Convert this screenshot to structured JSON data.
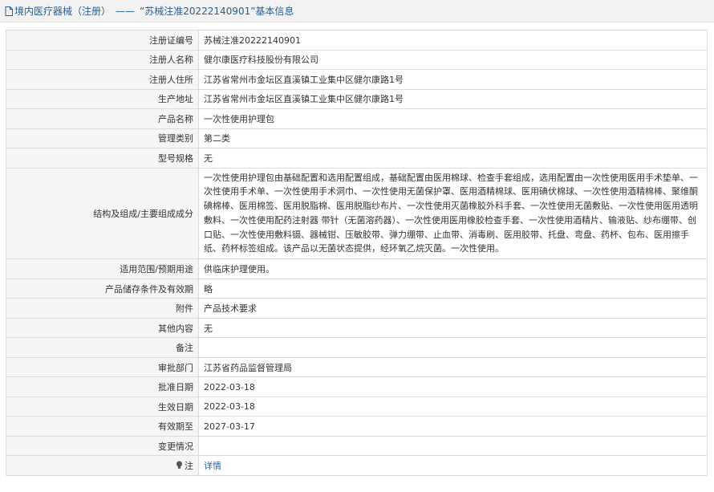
{
  "header": {
    "category": "境内医疗器械（注册）",
    "separator": "——",
    "title": "“苏械注准20222140901”基本信息"
  },
  "rows": [
    {
      "label": "注册证编号",
      "value": "苏械注准20222140901"
    },
    {
      "label": "注册人名称",
      "value": "健尔康医疗科技股份有限公司"
    },
    {
      "label": "注册人住所",
      "value": "江苏省常州市金坛区直溪镇工业集中区健尔康路1号"
    },
    {
      "label": "生产地址",
      "value": "江苏省常州市金坛区直溪镇工业集中区健尔康路1号"
    },
    {
      "label": "产品名称",
      "value": "一次性使用护理包"
    },
    {
      "label": "管理类别",
      "value": "第二类"
    },
    {
      "label": "型号规格",
      "value": "无"
    },
    {
      "label": "结构及组成/主要组成成分",
      "value": "一次性使用护理包由基础配置和选用配置组成，基础配置由医用棉球、检查手套组成，选用配置由一次性使用医用手术垫单、一次性使用手术单、一次性使用手术洞巾、一次性使用无菌保护罩、医用酒精棉球、医用碘伏棉球、一次性使用酒精棉棒、聚维酮碘棉棒、医用棉签、医用脱脂棉、医用脱脂纱布片、一次性使用灭菌橡胶外科手套、一次性使用无菌敷贴、一次性使用医用透明敷料、一次性使用配药注射器 带针（无菌溶药器）、一次性使用医用橡胶检查手套、一次性使用酒精片、输液贴、纱布绷带、创口贴、一次性使用敷料镊、器械钳、压敏胶带、弹力绷带、止血带、消毒刷、医用胶带、托盘、弯盘、药杯、包布、医用擦手纸、药杯标签组成。该产品以无菌状态提供，经环氧乙烷灭菌。一次性使用。"
    },
    {
      "label": "适用范围/预期用途",
      "value": "供临床护理使用。"
    },
    {
      "label": "产品储存条件及有效期",
      "value": "略"
    },
    {
      "label": "附件",
      "value": "产品技术要求"
    },
    {
      "label": "其他内容",
      "value": "无"
    },
    {
      "label": "备注",
      "value": ""
    },
    {
      "label": "审批部门",
      "value": "江苏省药品监督管理局"
    },
    {
      "label": "批准日期",
      "value": "2022-03-18"
    },
    {
      "label": "生效日期",
      "value": "2022-03-18"
    },
    {
      "label": "有效期至",
      "value": "2027-03-17"
    },
    {
      "label": "变更情况",
      "value": ""
    },
    {
      "label": "注",
      "value": "详情"
    }
  ],
  "icons": {
    "header": "document-icon",
    "note": "lightbulb-icon"
  },
  "colors": {
    "header_text": "#2a5c92",
    "link": "#1a63b0",
    "label_bg": "#f5f5f5"
  }
}
